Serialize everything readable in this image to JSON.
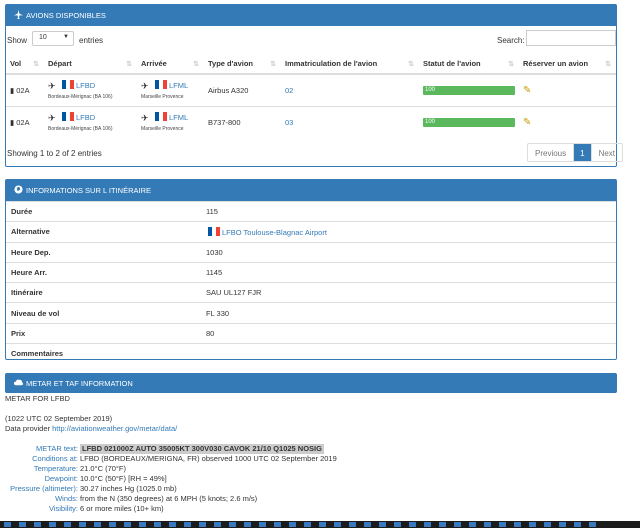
{
  "panel1": {
    "title": "AVIONS DISPONIBLES",
    "show_label": "Show",
    "entries_value": "10",
    "entries_label": "entries",
    "search_label": "Search:",
    "columns": [
      "Vol",
      "Départ",
      "Arrivée",
      "Type d'avion",
      "Immatriculation de l'avion",
      "Statut de l'avion",
      "Réserver un avion"
    ],
    "rows": [
      {
        "vol": "02A",
        "dep_code": "LFBD",
        "dep_name": "Bordeaux-Mérignac (BA 106)",
        "arr_code": "LFML",
        "arr_name": "Marseille Provence",
        "type": "Airbus A320",
        "immat": "02",
        "status": "100"
      },
      {
        "vol": "02A",
        "dep_code": "LFBD",
        "dep_name": "Bordeaux-Mérignac (BA 106)",
        "arr_code": "LFML",
        "arr_name": "Marseille Provence",
        "type": "B737-800",
        "immat": "03",
        "status": "100"
      }
    ],
    "info": "Showing 1 to 2 of 2 entries",
    "prev": "Previous",
    "page": "1",
    "next": "Next"
  },
  "panel2": {
    "title": "INFORMATIONS SUR L ITINÉRAIRE",
    "rows": [
      {
        "label": "Durée",
        "value": "115"
      },
      {
        "label": "Alternative",
        "value": "LFBO Toulouse-Blagnac Airport"
      },
      {
        "label": "Heure Dep.",
        "value": "1030"
      },
      {
        "label": "Heure Arr.",
        "value": "1145"
      },
      {
        "label": "Itinéraire",
        "value": "SAU UL127 FJR"
      },
      {
        "label": "Niveau de vol",
        "value": "FL 330"
      },
      {
        "label": "Prix",
        "value": "80"
      },
      {
        "label": "Commentaires",
        "value": ""
      }
    ]
  },
  "panel3": {
    "title": "METAR ET TAF INFORMATION",
    "metar_for": "METAR FOR LFBD",
    "time": "(1022 UTC 02 September 2019)",
    "provider_label": "Data provider",
    "provider_link": "http://aviationweather.gov/metar/data/",
    "fields": [
      {
        "k": "METAR text:",
        "v": "LFBD 021000Z AUTO 35005KT 300V030 CAVOK 21/10 Q1025 NOSIG"
      },
      {
        "k": "Conditions at:",
        "v": "LFBD (BORDEAUX/MERIGNA, FR) observed 1000 UTC 02 September 2019"
      },
      {
        "k": "Temperature:",
        "v": "21.0°C (70°F)"
      },
      {
        "k": "Dewpoint:",
        "v": "10.0°C (50°F) [RH = 49%]"
      },
      {
        "k": "Pressure (altimeter):",
        "v": "30.27 inches Hg (1025.0 mb)"
      },
      {
        "k": "Winds:",
        "v": "from the N (350 degrees) at 6 MPH (5 knots; 2.6 m/s)"
      },
      {
        "k": "Visibility:",
        "v": "6 or more miles (10+ km)"
      }
    ]
  }
}
